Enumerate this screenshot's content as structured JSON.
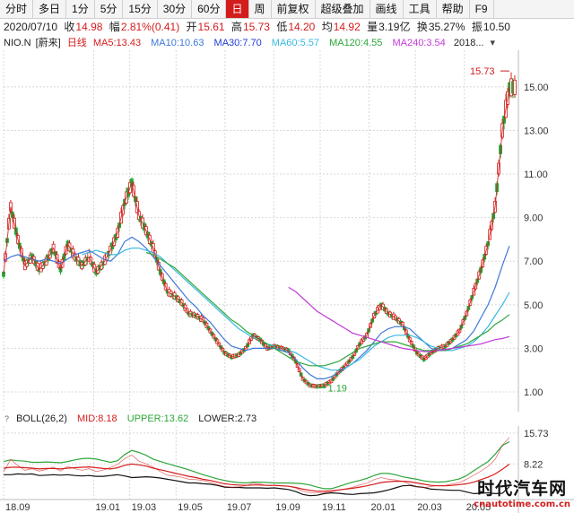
{
  "toolbar": {
    "items": [
      {
        "label": "分时",
        "active": false
      },
      {
        "label": "多日",
        "active": false
      },
      {
        "label": "1分",
        "active": false
      },
      {
        "label": "5分",
        "active": false
      },
      {
        "label": "15分",
        "active": false
      },
      {
        "label": "30分",
        "active": false
      },
      {
        "label": "60分",
        "active": false
      },
      {
        "label": "日",
        "active": true
      },
      {
        "label": "周",
        "active": false
      },
      {
        "label": "前复权",
        "active": false
      },
      {
        "label": "超级叠加",
        "active": false
      },
      {
        "label": "画线",
        "active": false
      },
      {
        "label": "工具",
        "active": false
      },
      {
        "label": "帮助",
        "active": false
      },
      {
        "label": "F9",
        "active": false
      }
    ]
  },
  "quote": {
    "date": "2020/07/10",
    "close_label": "收",
    "close": "14.98",
    "change_label": "幅",
    "change": "2.81%(0.41)",
    "open_label": "开",
    "open": "15.61",
    "high_label": "高",
    "high": "15.73",
    "low_label": "低",
    "low": "14.20",
    "avg_label": "均",
    "avg": "14.92",
    "volume_label": "量",
    "volume": "3.19亿",
    "turnover_label": "换",
    "turnover": "35.27%",
    "amplitude_label": "振",
    "amplitude": "10.50"
  },
  "ma_bar": {
    "symbol": "NIO.N",
    "adj": "[蔚来]",
    "period": "日线",
    "ma5": "MA5:13.43",
    "ma10": "MA10:10.63",
    "ma30": "MA30:7.70",
    "ma60": "MA60:5.57",
    "ma120": "MA120:4.55",
    "ma240": "MA240:3.54",
    "more": "2018..."
  },
  "boll_bar": {
    "name": "BOLL(26,2)",
    "mid": "MID:8.18",
    "upper": "UPPER:13.62",
    "lower": "LOWER:2.73"
  },
  "colors": {
    "ma5": "#d41c1c",
    "ma10": "#3c78d8",
    "ma30": "#1f3bd6",
    "ma60": "#39b8e0",
    "ma120": "#2ea63b",
    "ma240": "#c03ad6",
    "up": "#d41c1c",
    "down": "#22a83a"
  },
  "chart_data": [
    {
      "type": "candlestick",
      "title": "NIO.N 日线",
      "ylim": [
        0.3,
        16.6
      ],
      "y_ticks": [
        "15.00",
        "13.00",
        "11.00",
        "9.00",
        "7.00",
        "5.00",
        "3.00",
        "1.00"
      ],
      "x_ticks": [
        "18.09",
        "19.01",
        "19.03",
        "19.05",
        "19.07",
        "19.09",
        "19.11",
        "20.01",
        "20.03",
        "20.05"
      ],
      "annotations": {
        "max_label": "15.73",
        "min_label": "1.19"
      },
      "close_series": [
        6.4,
        9.5,
        8.0,
        6.8,
        7.2,
        6.6,
        7.0,
        7.6,
        6.6,
        7.8,
        7.2,
        6.8,
        7.2,
        6.5,
        6.9,
        7.5,
        8.3,
        9.7,
        10.6,
        9.1,
        8.4,
        7.6,
        6.5,
        5.6,
        5.4,
        5.1,
        4.6,
        4.5,
        4.3,
        3.8,
        3.3,
        2.8,
        2.6,
        2.7,
        3.0,
        3.6,
        3.4,
        3.0,
        3.1,
        3.0,
        2.9,
        2.4,
        1.6,
        1.3,
        1.25,
        1.3,
        1.5,
        1.9,
        2.2,
        2.6,
        3.2,
        3.6,
        4.5,
        5.0,
        4.6,
        4.4,
        4.1,
        3.4,
        2.8,
        2.5,
        2.8,
        3.0,
        3.1,
        3.4,
        3.8,
        4.6,
        5.6,
        6.6,
        7.8,
        9.5,
        13.0,
        14.98
      ],
      "series_names": [
        "MA5",
        "MA10",
        "MA30",
        "MA60",
        "MA120",
        "MA240"
      ],
      "series": [
        {
          "name": "MA30",
          "values": [
            7.0,
            7.2,
            7.3,
            7.2,
            7.1,
            7.0,
            7.1,
            7.0,
            6.9,
            7.1,
            7.3,
            7.4,
            7.5,
            7.3,
            7.1,
            7.0,
            7.3,
            7.9,
            8.1,
            7.9,
            7.6,
            7.2,
            6.8,
            6.4,
            6.0,
            5.6,
            5.2,
            4.9,
            4.5,
            4.2,
            3.8,
            3.4,
            3.1,
            3.0,
            2.9,
            3.0,
            3.0,
            3.0,
            3.0,
            2.9,
            2.8,
            2.5,
            2.1,
            1.8,
            1.6,
            1.6,
            1.7,
            1.9,
            2.1,
            2.3,
            2.6,
            2.9,
            3.3,
            3.7,
            3.9,
            4.0,
            4.0,
            3.9,
            3.6,
            3.3,
            3.0,
            2.9,
            2.9,
            3.0,
            3.2,
            3.4,
            3.8,
            4.4,
            5.0,
            5.8,
            6.8,
            7.7
          ]
        },
        {
          "name": "MA60",
          "values": [
            null,
            null,
            null,
            null,
            null,
            null,
            null,
            null,
            null,
            null,
            null,
            7.3,
            7.4,
            7.5,
            7.4,
            7.3,
            7.3,
            7.5,
            7.6,
            7.6,
            7.5,
            7.4,
            7.2,
            6.9,
            6.6,
            6.3,
            6.0,
            5.7,
            5.4,
            5.1,
            4.8,
            4.5,
            4.2,
            3.9,
            3.7,
            3.5,
            3.4,
            3.2,
            3.1,
            3.0,
            2.9,
            2.8,
            2.6,
            2.4,
            2.2,
            2.1,
            2.0,
            2.0,
            2.1,
            2.3,
            2.5,
            2.8,
            3.1,
            3.3,
            3.5,
            3.6,
            3.6,
            3.6,
            3.5,
            3.3,
            3.1,
            3.0,
            2.9,
            2.9,
            3.0,
            3.1,
            3.3,
            3.6,
            4.0,
            4.5,
            5.0,
            5.57
          ]
        },
        {
          "name": "MA120",
          "values": [
            null,
            null,
            null,
            null,
            null,
            null,
            null,
            null,
            null,
            null,
            null,
            null,
            null,
            null,
            null,
            null,
            null,
            null,
            null,
            null,
            7.4,
            7.3,
            7.1,
            6.9,
            6.7,
            6.4,
            6.1,
            5.8,
            5.5,
            5.2,
            4.9,
            4.6,
            4.3,
            4.1,
            3.8,
            3.6,
            3.4,
            3.2,
            3.0,
            2.8,
            2.6,
            2.4,
            2.3,
            2.2,
            2.2,
            2.2,
            2.3,
            2.4,
            2.6,
            2.8,
            3.0,
            3.1,
            3.2,
            3.3,
            3.3,
            3.3,
            3.2,
            3.1,
            3.0,
            2.9,
            2.9,
            2.9,
            2.9,
            3.0,
            3.1,
            3.2,
            3.4,
            3.6,
            3.8,
            4.1,
            4.3,
            4.55
          ]
        },
        {
          "name": "MA240",
          "values": [
            null,
            null,
            null,
            null,
            null,
            null,
            null,
            null,
            null,
            null,
            null,
            null,
            null,
            null,
            null,
            null,
            null,
            null,
            null,
            null,
            null,
            null,
            null,
            null,
            null,
            null,
            null,
            null,
            null,
            null,
            null,
            null,
            null,
            null,
            null,
            null,
            null,
            null,
            null,
            null,
            5.8,
            5.6,
            5.3,
            5.0,
            4.7,
            4.5,
            4.3,
            4.1,
            3.9,
            3.7,
            3.6,
            3.5,
            3.4,
            3.3,
            3.2,
            3.1,
            3.0,
            2.95,
            2.9,
            2.85,
            2.85,
            2.9,
            2.95,
            3.0,
            3.05,
            3.1,
            3.15,
            3.2,
            3.3,
            3.4,
            3.45,
            3.54
          ]
        }
      ]
    },
    {
      "type": "line",
      "title": "BOLL(26,2)",
      "ylim": [
        0.0,
        17.0
      ],
      "y_ticks": [
        "15.73",
        "8.22"
      ],
      "x_ticks": [
        "18.09",
        "19.01",
        "19.03",
        "19.05",
        "19.07",
        "19.09",
        "19.11",
        "20.01",
        "20.03",
        "20.05"
      ],
      "series": [
        {
          "name": "UPPER",
          "values": [
            8.8,
            9.2,
            9.0,
            8.9,
            8.6,
            8.6,
            8.7,
            8.6,
            8.5,
            8.8,
            9.2,
            9.5,
            9.6,
            9.4,
            9.0,
            8.6,
            9.0,
            10.5,
            11.5,
            11.0,
            10.3,
            9.4,
            8.8,
            8.3,
            7.8,
            7.3,
            6.8,
            6.2,
            5.6,
            5.1,
            4.6,
            4.2,
            3.9,
            3.7,
            3.6,
            3.8,
            3.8,
            3.7,
            3.6,
            3.6,
            3.6,
            3.5,
            3.4,
            3.1,
            2.6,
            2.2,
            2.2,
            2.7,
            3.3,
            3.8,
            4.2,
            4.7,
            5.4,
            5.9,
            5.9,
            5.6,
            5.1,
            4.8,
            4.5,
            4.1,
            3.9,
            3.8,
            3.9,
            4.2,
            4.6,
            5.4,
            6.6,
            7.7,
            8.8,
            10.6,
            12.7,
            13.62
          ]
        },
        {
          "name": "MID",
          "values": [
            7.2,
            7.4,
            7.4,
            7.3,
            7.2,
            7.0,
            7.1,
            7.1,
            7.0,
            7.2,
            7.3,
            7.4,
            7.5,
            7.3,
            7.1,
            7.0,
            7.3,
            7.9,
            8.2,
            8.0,
            7.7,
            7.2,
            6.8,
            6.4,
            6.0,
            5.6,
            5.2,
            4.9,
            4.5,
            4.2,
            3.8,
            3.4,
            3.2,
            3.1,
            3.0,
            3.1,
            3.1,
            3.0,
            3.0,
            2.9,
            2.8,
            2.5,
            2.1,
            1.8,
            1.6,
            1.6,
            1.7,
            1.9,
            2.1,
            2.3,
            2.6,
            2.9,
            3.3,
            3.7,
            3.9,
            4.0,
            4.0,
            3.9,
            3.6,
            3.3,
            3.0,
            2.9,
            2.9,
            3.0,
            3.2,
            3.4,
            3.8,
            4.4,
            5.0,
            5.8,
            6.9,
            8.18
          ]
        },
        {
          "name": "LOWER",
          "values": [
            5.6,
            5.6,
            5.8,
            5.7,
            5.8,
            5.4,
            5.5,
            5.6,
            5.5,
            5.6,
            5.4,
            5.3,
            5.4,
            5.2,
            5.2,
            5.4,
            5.6,
            5.3,
            4.9,
            5.0,
            5.1,
            5.0,
            4.8,
            4.5,
            4.2,
            3.9,
            3.6,
            3.6,
            3.4,
            3.3,
            3.0,
            2.6,
            2.5,
            2.5,
            2.4,
            2.4,
            2.4,
            2.3,
            2.4,
            2.2,
            2.0,
            1.5,
            0.8,
            0.5,
            0.6,
            1.0,
            1.2,
            1.1,
            0.9,
            0.8,
            1.0,
            1.1,
            1.2,
            1.5,
            1.9,
            2.4,
            2.9,
            3.0,
            2.7,
            2.5,
            2.1,
            2.0,
            1.9,
            1.8,
            1.8,
            1.4,
            1.0,
            1.1,
            1.2,
            1.0,
            1.1,
            2.73
          ]
        }
      ]
    }
  ]
}
